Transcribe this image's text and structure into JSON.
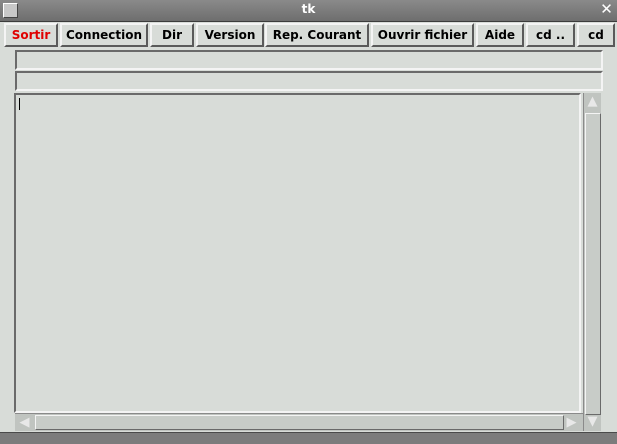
{
  "window": {
    "title": "tk",
    "close_glyph": "✕"
  },
  "toolbar": {
    "buttons": [
      {
        "label": "Sortir",
        "color": "#e00000"
      },
      {
        "label": "Connection"
      },
      {
        "label": "Dir"
      },
      {
        "label": "Version"
      },
      {
        "label": "Rep. Courant"
      },
      {
        "label": "Ouvrir fichier"
      },
      {
        "label": "Aide"
      },
      {
        "label": "cd .."
      },
      {
        "label": "cd"
      }
    ]
  },
  "entries": {
    "first_value": "",
    "second_value": ""
  },
  "text_area": {
    "content": ""
  },
  "scrollbars": {
    "up_glyph": "▲",
    "down_glyph": "▼",
    "left_glyph": "◀",
    "right_glyph": "▶"
  }
}
